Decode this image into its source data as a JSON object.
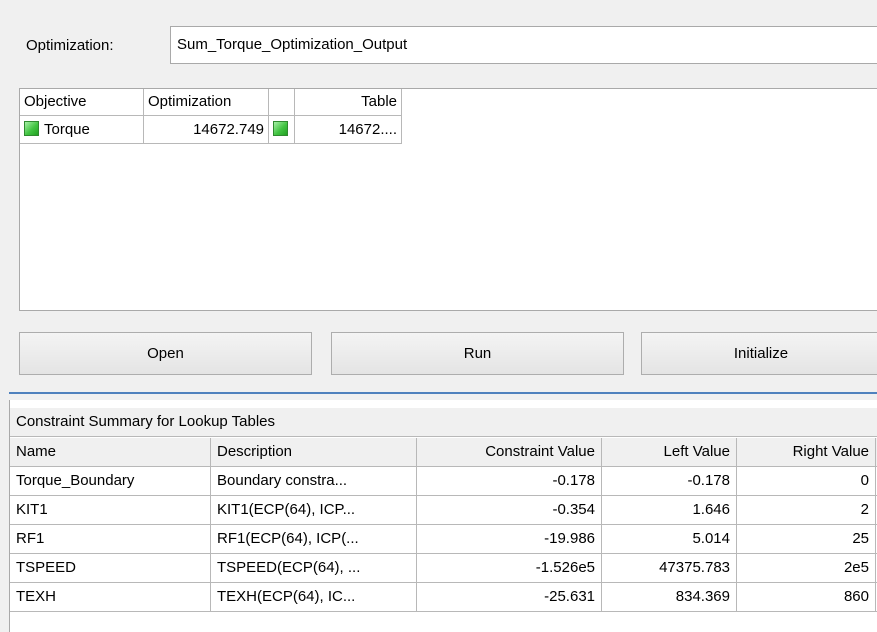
{
  "optimization": {
    "label": "Optimization:",
    "value": "Sum_Torque_Optimization_Output"
  },
  "objective_grid": {
    "headers": [
      "Objective",
      "Optimization",
      "",
      "Table"
    ],
    "rows": [
      {
        "objective": "Torque",
        "optimization": "14672.749",
        "table": "14672...."
      }
    ],
    "status_color": "#3cc43c"
  },
  "buttons": {
    "open": "Open",
    "run": "Run",
    "initialize": "Initialize"
  },
  "accent_color": "#4f81bd",
  "constraint_summary": {
    "title": "Constraint Summary for Lookup Tables",
    "headers": [
      "Name",
      "Description",
      "Constraint Value",
      "Left Value",
      "Right Value"
    ],
    "rows": [
      [
        "Torque_Boundary",
        "Boundary constra...",
        "-0.178",
        "-0.178",
        "0"
      ],
      [
        "KIT1",
        "KIT1(ECP(64), ICP...",
        "-0.354",
        "1.646",
        "2"
      ],
      [
        "RF1",
        "RF1(ECP(64), ICP(...",
        "-19.986",
        "5.014",
        "25"
      ],
      [
        "TSPEED",
        "TSPEED(ECP(64), ...",
        "-1.526e5",
        "47375.783",
        "2e5"
      ],
      [
        "TEXH",
        "TEXH(ECP(64), IC...",
        "-25.631",
        "834.369",
        "860"
      ]
    ]
  }
}
